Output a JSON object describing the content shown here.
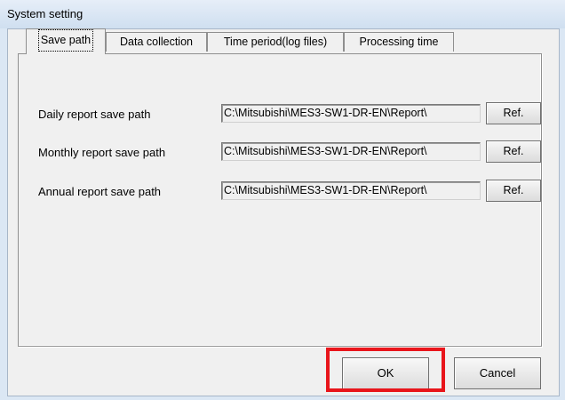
{
  "window": {
    "title": "System setting"
  },
  "tabs": [
    {
      "label": "Save path"
    },
    {
      "label": "Data collection"
    },
    {
      "label": "Time period(log files)"
    },
    {
      "label": "Processing time"
    }
  ],
  "rows": [
    {
      "label": "Daily report save path",
      "path": "C:\\Mitsubishi\\MES3-SW1-DR-EN\\Report\\",
      "button": "Ref."
    },
    {
      "label": "Monthly report save path",
      "path": "C:\\Mitsubishi\\MES3-SW1-DR-EN\\Report\\",
      "button": "Ref."
    },
    {
      "label": "Annual report save path",
      "path": "C:\\Mitsubishi\\MES3-SW1-DR-EN\\Report\\",
      "button": "Ref."
    }
  ],
  "buttons": {
    "ok": "OK",
    "cancel": "Cancel"
  },
  "highlight_color": "#e8151b"
}
